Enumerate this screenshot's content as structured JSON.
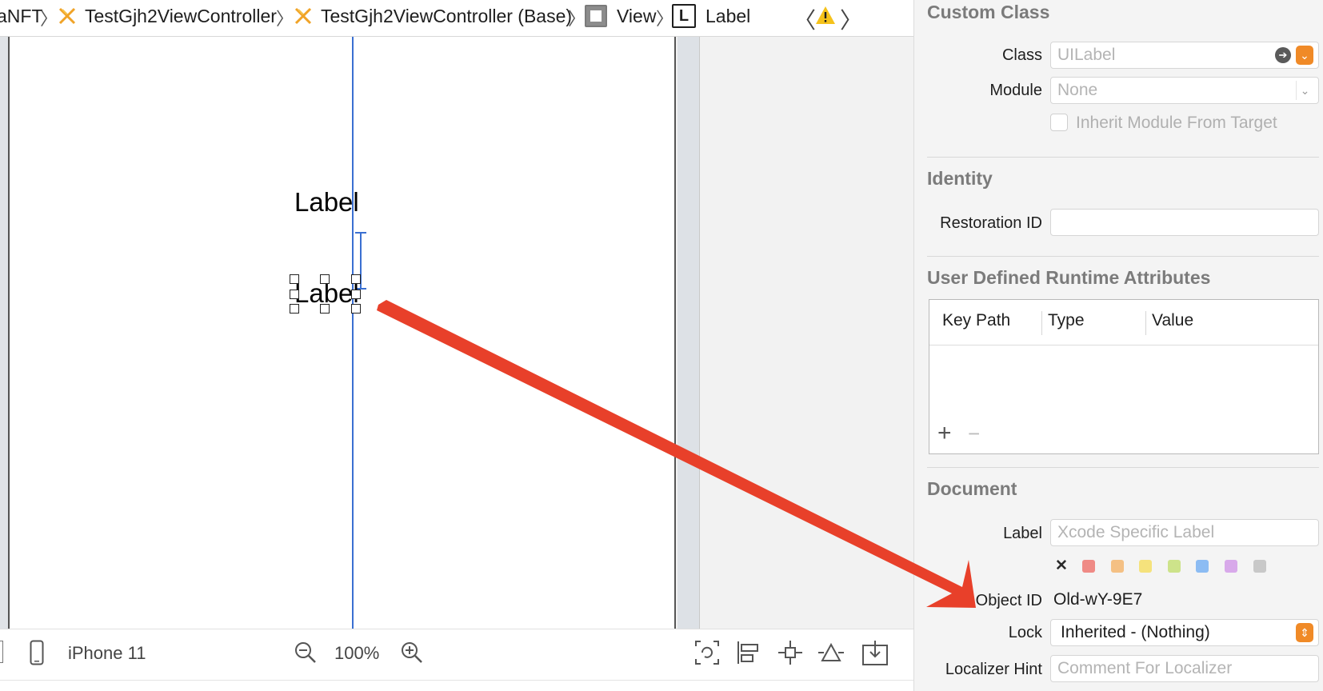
{
  "breadcrumb": {
    "items": [
      {
        "label": "aNFT"
      },
      {
        "label": "TestGjh2ViewController",
        "icon": "swift-icon"
      },
      {
        "label": "TestGjh2ViewController (Base)",
        "icon": "swift-icon"
      },
      {
        "label": "View",
        "icon": "view-icon"
      },
      {
        "label": "Label",
        "icon": "label-icon",
        "icon_text": "L"
      }
    ],
    "separator": "〉",
    "nav_back": "〈",
    "nav_forward": "〉",
    "warning_icon": "warning-icon"
  },
  "canvas": {
    "labels": [
      "Label",
      "Label"
    ],
    "guide_color": "#3a6fd1",
    "annotation_arrow_color": "#e8402a"
  },
  "bottom_bar": {
    "device": "iPhone 11",
    "zoom": "100%"
  },
  "inspector": {
    "custom_class": {
      "title": "Custom Class",
      "class_label": "Class",
      "class_placeholder": "UILabel",
      "module_label": "Module",
      "module_placeholder": "None",
      "inherit_label": "Inherit Module From Target"
    },
    "identity": {
      "title": "Identity",
      "restoration_label": "Restoration ID",
      "restoration_value": ""
    },
    "runtime_attributes": {
      "title": "User Defined Runtime Attributes",
      "columns": [
        "Key Path",
        "Type",
        "Value"
      ],
      "add": "+",
      "remove": "−"
    },
    "document": {
      "title": "Document",
      "label_label": "Label",
      "label_placeholder": "Xcode Specific Label",
      "clear_glyph": "✕",
      "colors": [
        "#ef8a85",
        "#f4c084",
        "#f5e27c",
        "#cde38a",
        "#8cbcf3",
        "#d8a9ea",
        "#c8c8c8"
      ],
      "object_id_label": "Object ID",
      "object_id_value": "Old-wY-9E7",
      "lock_label": "Lock",
      "lock_value": "Inherited - (Nothing)",
      "localizer_label": "Localizer Hint",
      "localizer_placeholder": "Comment For Localizer"
    },
    "accent_color": "#f08a27"
  }
}
